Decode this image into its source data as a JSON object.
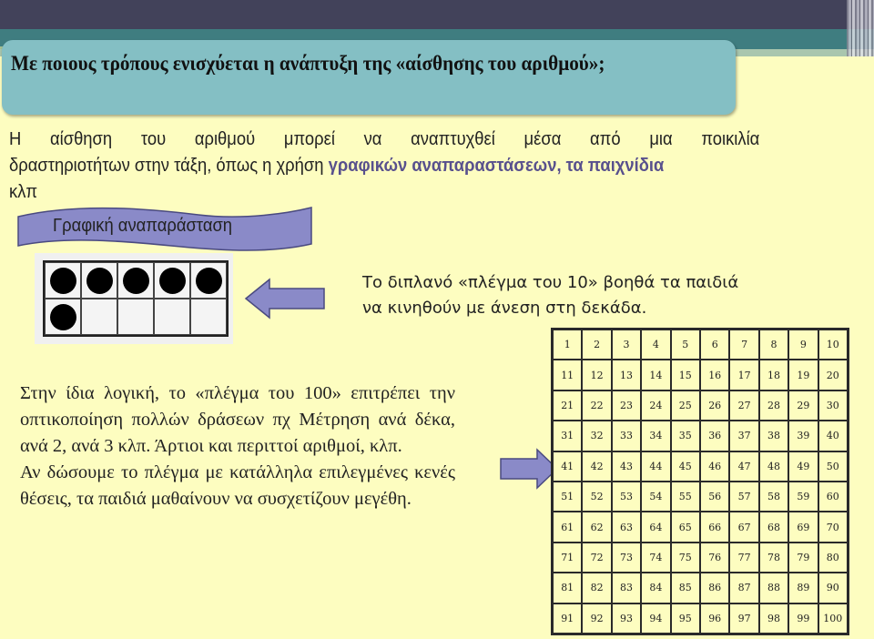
{
  "slide": {
    "title": "Με ποιους τρόπους ενισχύεται η ανάπτυξη της «αίσθησης του αριθμού»;",
    "intro": {
      "line1": "Η αίσθηση του αριθμού μπορεί να αναπτυχθεί μέσα από μια ποικιλία",
      "line2_plain": "δραστηριοτήτων στην τάξη, όπως η χρήση ",
      "line2_highlight": "γραφικών αναπαραστάσεων, τα παιχνίδια",
      "line3": "κλπ"
    },
    "banner_label": "Γραφική αναπαράσταση",
    "ten_frame": {
      "filled_count": 6,
      "total_cells": 10,
      "caption": "Το διπλανό «πλέγμα του 10» βοηθά τα παιδιά να κινηθούν με άνεση στη δεκάδα."
    },
    "hundred_text": {
      "paragraph1": "Στην ίδια λογική, το «πλέγμα του 100» επιτρέπει την οπτικοποίηση πολλών δράσεων πχ  Μέτρηση ανά δέκα, ανά 2, ανά 3 κλπ. Άρτιοι και περιττοί αριθμοί, κλπ.",
      "paragraph2": "Αν δώσουμε το πλέγμα με κατάλληλα επιλεγμένες κενές θέσεις, τα παιδιά μαθαίνουν να συσχετίζουν μεγέθη."
    },
    "hundred_grid": {
      "start": 1,
      "end": 100,
      "columns": 10
    },
    "colors": {
      "background": "#fdfdc0",
      "title_box": "#84bfc4",
      "highlight": "#58508d",
      "arrow": "#8a8ac8",
      "banner": "#8a8ac8"
    }
  }
}
